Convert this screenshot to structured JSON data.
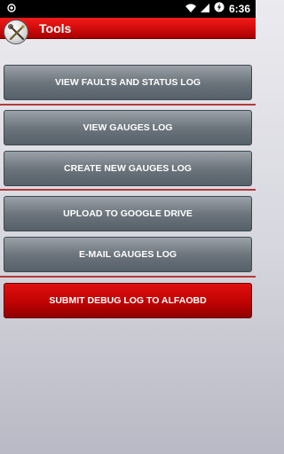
{
  "status_bar": {
    "time": "6:36",
    "icons": [
      "notification-dot-icon",
      "wifi-icon",
      "signal-icon",
      "battery-charging-icon"
    ]
  },
  "app_bar": {
    "title": "Tools",
    "logo_icon": "wrench-screwdriver-logo-icon"
  },
  "colors": {
    "app_bar": "#d30c0c",
    "button_gray": "#6d757d",
    "button_red": "#c00202",
    "divider": "#b33a3a"
  },
  "buttons": {
    "view_faults": "VIEW FAULTS AND STATUS LOG",
    "view_gauges": "VIEW GAUGES LOG",
    "create_gauges": "CREATE NEW GAUGES LOG",
    "upload_drive": "UPLOAD TO GOOGLE DRIVE",
    "email_gauges": "E-MAIL GAUGES LOG",
    "submit_debug": "SUBMIT DEBUG LOG TO ALFAOBD"
  }
}
